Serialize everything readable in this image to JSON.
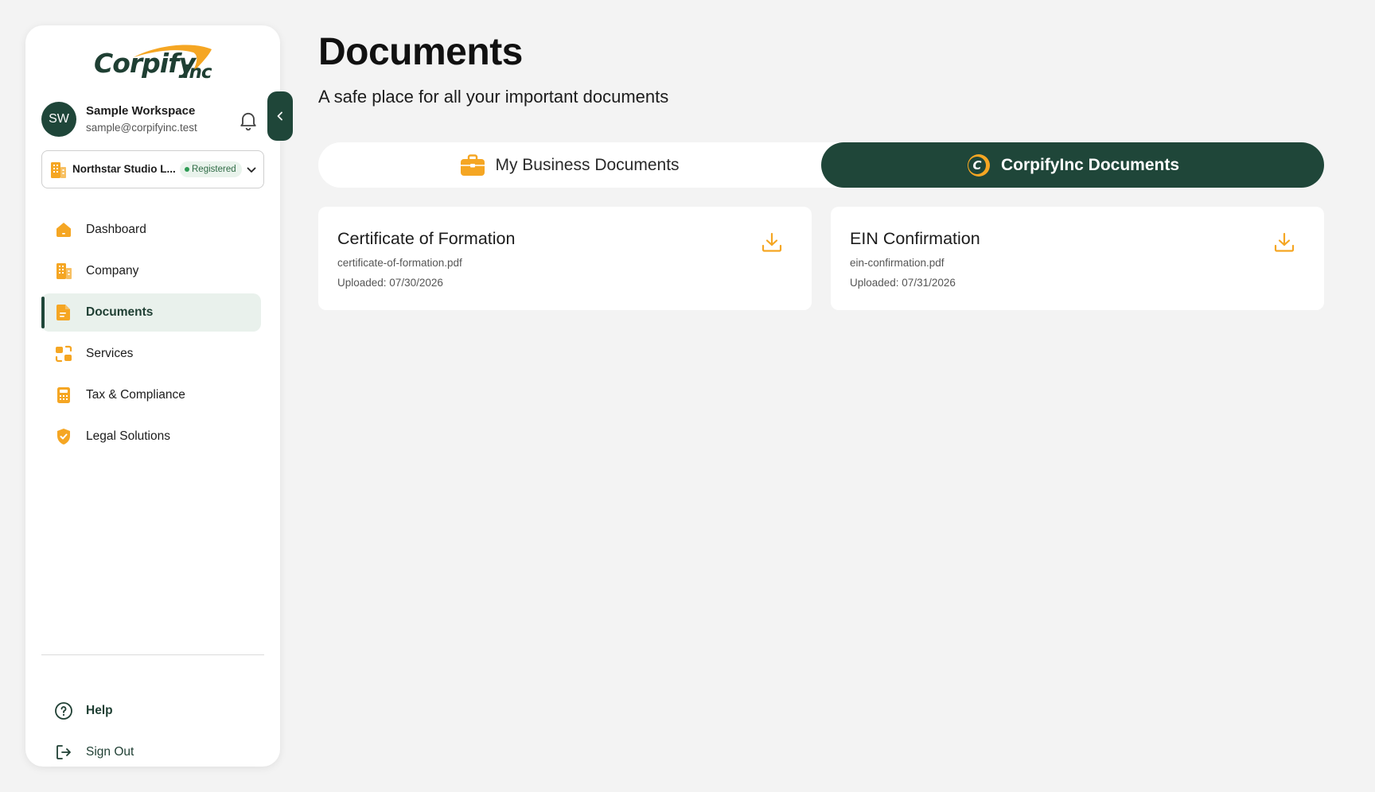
{
  "brand": {
    "logo_main": "Corpify",
    "logo_suffix": "Inc",
    "primary_color": "#1f4639",
    "accent_color": "#f5a623"
  },
  "user": {
    "initials": "SW",
    "name": "Sample Workspace",
    "email": "sample@corpifyinc.test"
  },
  "company_selector": {
    "name": "Northstar Studio L...",
    "status": "Registered"
  },
  "nav": {
    "items": [
      {
        "label": "Dashboard",
        "icon": "home-icon"
      },
      {
        "label": "Company",
        "icon": "building-icon"
      },
      {
        "label": "Documents",
        "icon": "document-icon",
        "active": true
      },
      {
        "label": "Services",
        "icon": "services-icon"
      },
      {
        "label": "Tax & Compliance",
        "icon": "calculator-icon"
      },
      {
        "label": "Legal Solutions",
        "icon": "shield-check-icon"
      }
    ],
    "help_label": "Help",
    "signout_label": "Sign Out"
  },
  "page": {
    "title": "Documents",
    "subtitle": "A safe place for all your important documents"
  },
  "tabs": {
    "business_label": "My Business Documents",
    "corpify_label": "CorpifyInc Documents",
    "active": "CorpifyInc Documents"
  },
  "documents": [
    {
      "title": "Certificate of Formation",
      "file": "certificate-of-formation.pdf",
      "uploaded": "Uploaded: 07/30/2026"
    },
    {
      "title": "EIN Confirmation",
      "file": "ein-confirmation.pdf",
      "uploaded": "Uploaded: 07/31/2026"
    }
  ]
}
